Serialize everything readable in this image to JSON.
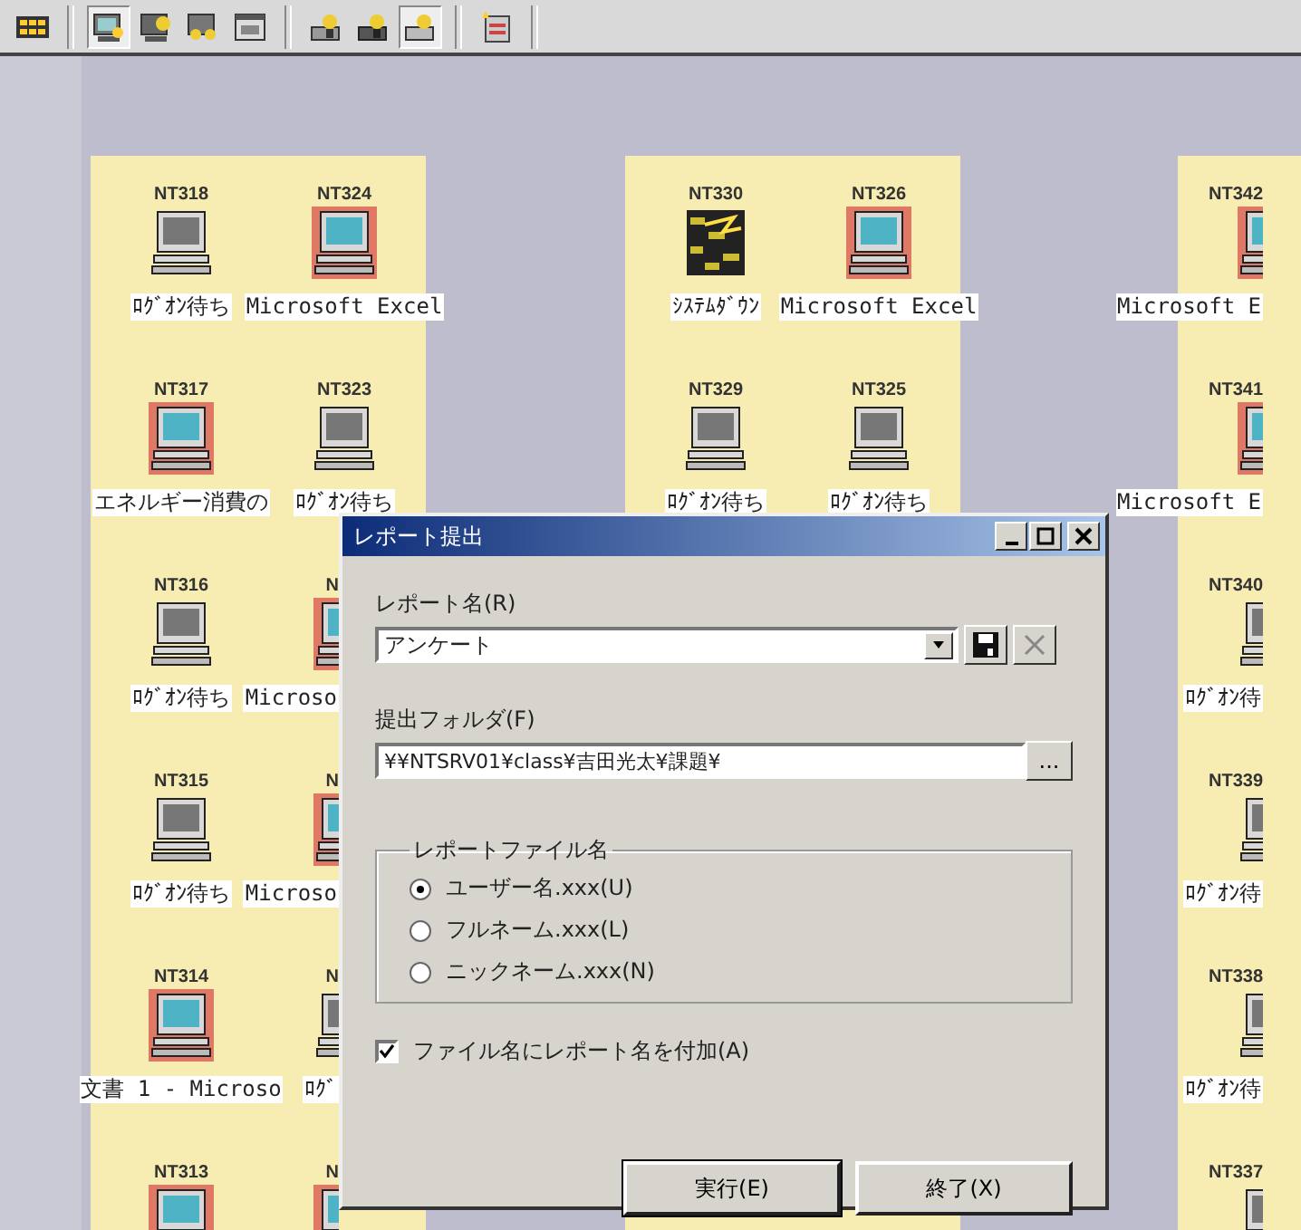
{
  "toolbar": {
    "groups": [
      [
        {
          "pressed": false
        }
      ],
      [
        {
          "pressed": true
        },
        {
          "pressed": false
        },
        {
          "pressed": false
        },
        {
          "pressed": false
        }
      ],
      [
        {
          "pressed": false
        },
        {
          "pressed": false
        },
        {
          "pressed": true
        }
      ],
      [
        {
          "pressed": false
        }
      ]
    ]
  },
  "groups": [
    {
      "rows": [
        [
          {
            "name": "NT318",
            "kind": "idle",
            "label": "ﾛｸﾞｵﾝ待ち"
          },
          {
            "name": "NT324",
            "kind": "app",
            "label": "Microsoft Excel"
          }
        ],
        [
          {
            "name": "NT317",
            "kind": "app",
            "label": "エネルギー消費の"
          },
          {
            "name": "NT323",
            "kind": "idle",
            "label": "ﾛｸﾞｵﾝ待ち"
          }
        ],
        [
          {
            "name": "NT316",
            "kind": "idle",
            "label": "ﾛｸﾞｵﾝ待ち"
          },
          {
            "name": "N",
            "kind": "app",
            "label": "Microso"
          }
        ],
        [
          {
            "name": "NT315",
            "kind": "idle",
            "label": "ﾛｸﾞｵﾝ待ち"
          },
          {
            "name": "N",
            "kind": "app",
            "label": "Microso"
          }
        ],
        [
          {
            "name": "NT314",
            "kind": "app",
            "label": "文書 1 - Microso"
          },
          {
            "name": "N",
            "kind": "idle",
            "label": "ﾛｸﾞ"
          }
        ],
        [
          {
            "name": "NT313",
            "kind": "app"
          },
          {
            "name": "N",
            "kind": "app"
          }
        ]
      ]
    },
    {
      "rows": [
        [
          {
            "name": "NT330",
            "kind": "down",
            "label": "ｼｽﾃﾑﾀﾞｳﾝ"
          },
          {
            "name": "NT326",
            "kind": "app",
            "label": "Microsoft Excel"
          }
        ],
        [
          {
            "name": "NT329",
            "kind": "idle",
            "label": "ﾛｸﾞｵﾝ待ち"
          },
          {
            "name": "NT325",
            "kind": "idle",
            "label": "ﾛｸﾞｵﾝ待ち"
          }
        ]
      ]
    },
    {
      "rows": [
        [
          {
            "name": "NT342",
            "kind": "app",
            "label": "Microsoft E"
          }
        ],
        [
          {
            "name": "NT341",
            "kind": "app",
            "label": "Microsoft E"
          }
        ],
        [
          {
            "name": "NT340",
            "kind": "idle",
            "label": "ﾛｸﾞｵﾝ待"
          }
        ],
        [
          {
            "name": "NT339",
            "kind": "idle",
            "label": "ﾛｸﾞｵﾝ待"
          }
        ],
        [
          {
            "name": "NT338",
            "kind": "idle",
            "label": "ﾛｸﾞｵﾝ待"
          }
        ],
        [
          {
            "name": "NT337",
            "kind": "idle"
          }
        ]
      ]
    }
  ],
  "dialog": {
    "title": "レポート提出",
    "report_name": {
      "label": "レポート名(R)",
      "value": "アンケート",
      "delete_disabled": true
    },
    "folder": {
      "label": "提出フォルダ(F)",
      "value": "¥¥NTSRV01¥class¥吉田光太¥課題¥",
      "browse_label": "..."
    },
    "file_name": {
      "legend": "レポートファイル名",
      "options": [
        {
          "label": "ユーザー名.xxx(U)",
          "selected": true
        },
        {
          "label": "フルネーム.xxx(L)",
          "selected": false
        },
        {
          "label": "ニックネーム.xxx(N)",
          "selected": false
        }
      ]
    },
    "append_name": {
      "label": "ファイル名にレポート名を付加(A)",
      "checked": true
    },
    "buttons": [
      "実行(E)",
      "終了(X)"
    ]
  }
}
